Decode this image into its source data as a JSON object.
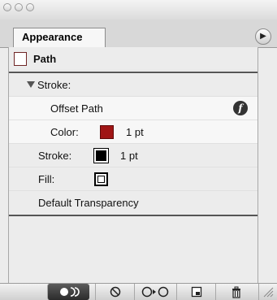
{
  "tab": {
    "label": "Appearance"
  },
  "rows": {
    "path": "Path",
    "stroke_group": "Stroke:",
    "offset_path": "Offset Path",
    "color_label": "Color:",
    "color_value": "1 pt",
    "stroke_label": "Stroke:",
    "stroke_value": "1 pt",
    "fill_label": "Fill:",
    "transparency": "Default Transparency"
  },
  "colors": {
    "color_swatch": "#a01515",
    "stroke_swatch": "#000000",
    "path_swatch_border": "#6f2626"
  },
  "icons": {
    "menu": "panel-menu-icon",
    "fx": "effect-icon",
    "toolbar": [
      "new-art-basic-appearance-icon",
      "clear-appearance-icon",
      "reduce-to-basic-appearance-icon",
      "duplicate-item-icon",
      "delete-item-icon"
    ]
  }
}
